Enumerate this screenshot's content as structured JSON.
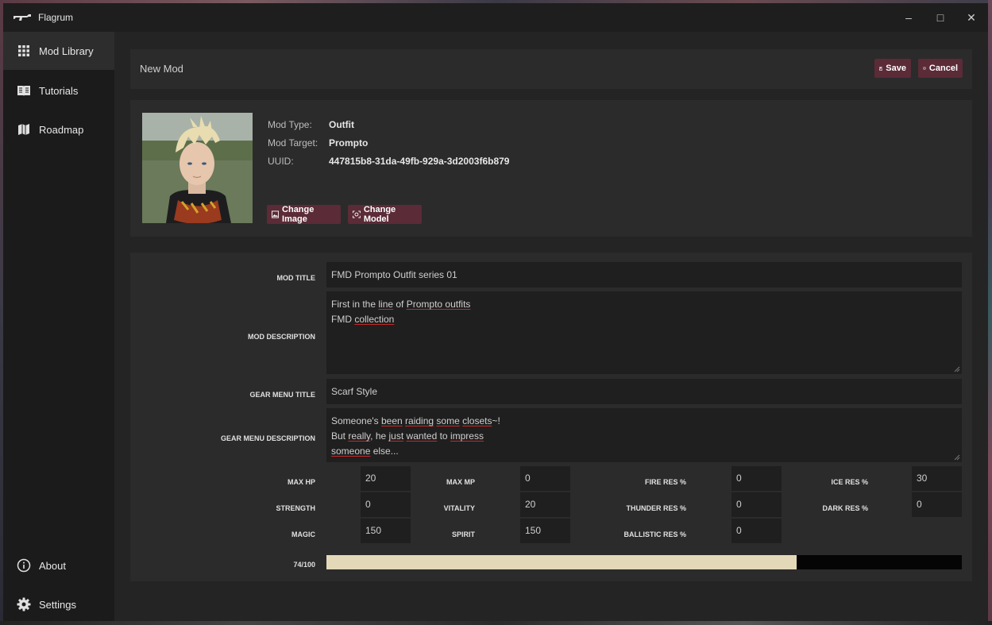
{
  "window": {
    "title": "Flagrum",
    "minimize_glyph": "–",
    "maximize_glyph": "□",
    "close_glyph": "✕"
  },
  "sidebar": {
    "items": [
      {
        "label": "Mod Library",
        "icon": "grid-icon",
        "active": true
      },
      {
        "label": "Tutorials",
        "icon": "book-icon",
        "active": false
      },
      {
        "label": "Roadmap",
        "icon": "map-icon",
        "active": false
      }
    ],
    "bottom_items": [
      {
        "label": "About",
        "icon": "info-icon"
      },
      {
        "label": "Settings",
        "icon": "gear-icon"
      }
    ]
  },
  "header": {
    "title": "New Mod",
    "save_label": "Save",
    "cancel_label": "Cancel"
  },
  "mod_info": {
    "type_label": "Mod Type:",
    "type_value": "Outfit",
    "target_label": "Mod Target:",
    "target_value": "Prompto",
    "uuid_label": "UUID:",
    "uuid_value": "447815b8-31da-49fb-929a-3d2003f6b879",
    "change_image_label": "Change Image",
    "change_model_label": "Change Model"
  },
  "form": {
    "mod_title_label": "MOD TITLE",
    "mod_title_value": "FMD Prompto Outfit series 01",
    "mod_description_label": "MOD DESCRIPTION",
    "mod_description_lines": [
      "First in the line of Prompto outfits",
      "FMD collection"
    ],
    "gear_menu_title_label": "GEAR MENU TITLE",
    "gear_menu_title_value": "Scarf Style",
    "gear_menu_description_label": "GEAR MENU DESCRIPTION",
    "gear_menu_description_lines": [
      "Someone's been raiding some closets~!",
      "But really, he just wanted to impress",
      "someone else..."
    ]
  },
  "stats": {
    "max_hp": {
      "label": "MAX HP",
      "value": "20"
    },
    "max_mp": {
      "label": "MAX MP",
      "value": "0"
    },
    "fire_res": {
      "label": "FIRE RES %",
      "value": "0"
    },
    "ice_res": {
      "label": "ICE RES %",
      "value": "30"
    },
    "strength": {
      "label": "STRENGTH",
      "value": "0"
    },
    "vitality": {
      "label": "VITALITY",
      "value": "20"
    },
    "thunder_res": {
      "label": "THUNDER RES %",
      "value": "0"
    },
    "dark_res": {
      "label": "DARK RES %",
      "value": "0"
    },
    "magic": {
      "label": "MAGIC",
      "value": "150"
    },
    "spirit": {
      "label": "SPIRIT",
      "value": "150"
    },
    "ballistic_res": {
      "label": "BALLISTIC RES %",
      "value": "0"
    }
  },
  "points": {
    "label": "74/100",
    "fraction": 0.74
  },
  "colors": {
    "accent": "#5b2b37",
    "progress_fill": "#e3d9b9",
    "progress_track": "#050505"
  }
}
